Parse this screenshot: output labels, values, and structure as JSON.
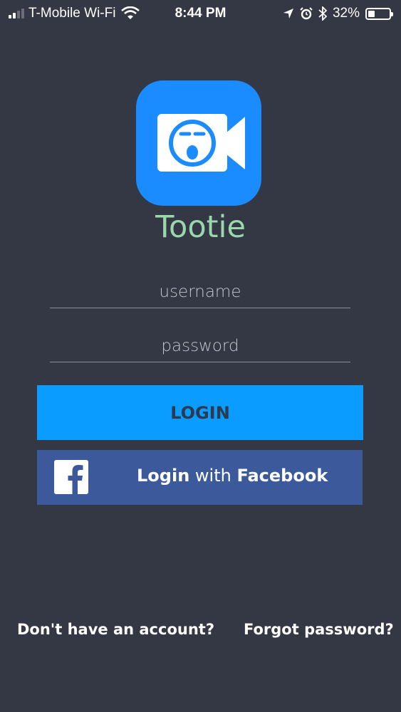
{
  "status_bar": {
    "carrier": "T-Mobile Wi-Fi",
    "time": "8:44 PM",
    "battery_percent": "32%",
    "battery_level": 0.32,
    "signal_bars": 2,
    "icons": [
      "signal-icon",
      "wifi-icon",
      "location-icon",
      "alarm-icon",
      "bluetooth-icon",
      "battery-icon"
    ]
  },
  "app": {
    "name": "Tootie",
    "icon": "video-camera-face-icon",
    "icon_color": "#1a8cff",
    "title_color": "#9bd7ad"
  },
  "form": {
    "username_placeholder": "username",
    "password_placeholder": "password"
  },
  "buttons": {
    "login_label": "LOGIN",
    "login_color": "#0a9cff",
    "facebook_prefix": "Login",
    "facebook_middle": " with ",
    "facebook_brand": "Facebook",
    "facebook_color": "#3c5a9b",
    "facebook_icon": "facebook-icon"
  },
  "links": {
    "signup": "Don't have an account?",
    "forgot": "Forgot password?"
  },
  "colors": {
    "background": "#343845"
  }
}
